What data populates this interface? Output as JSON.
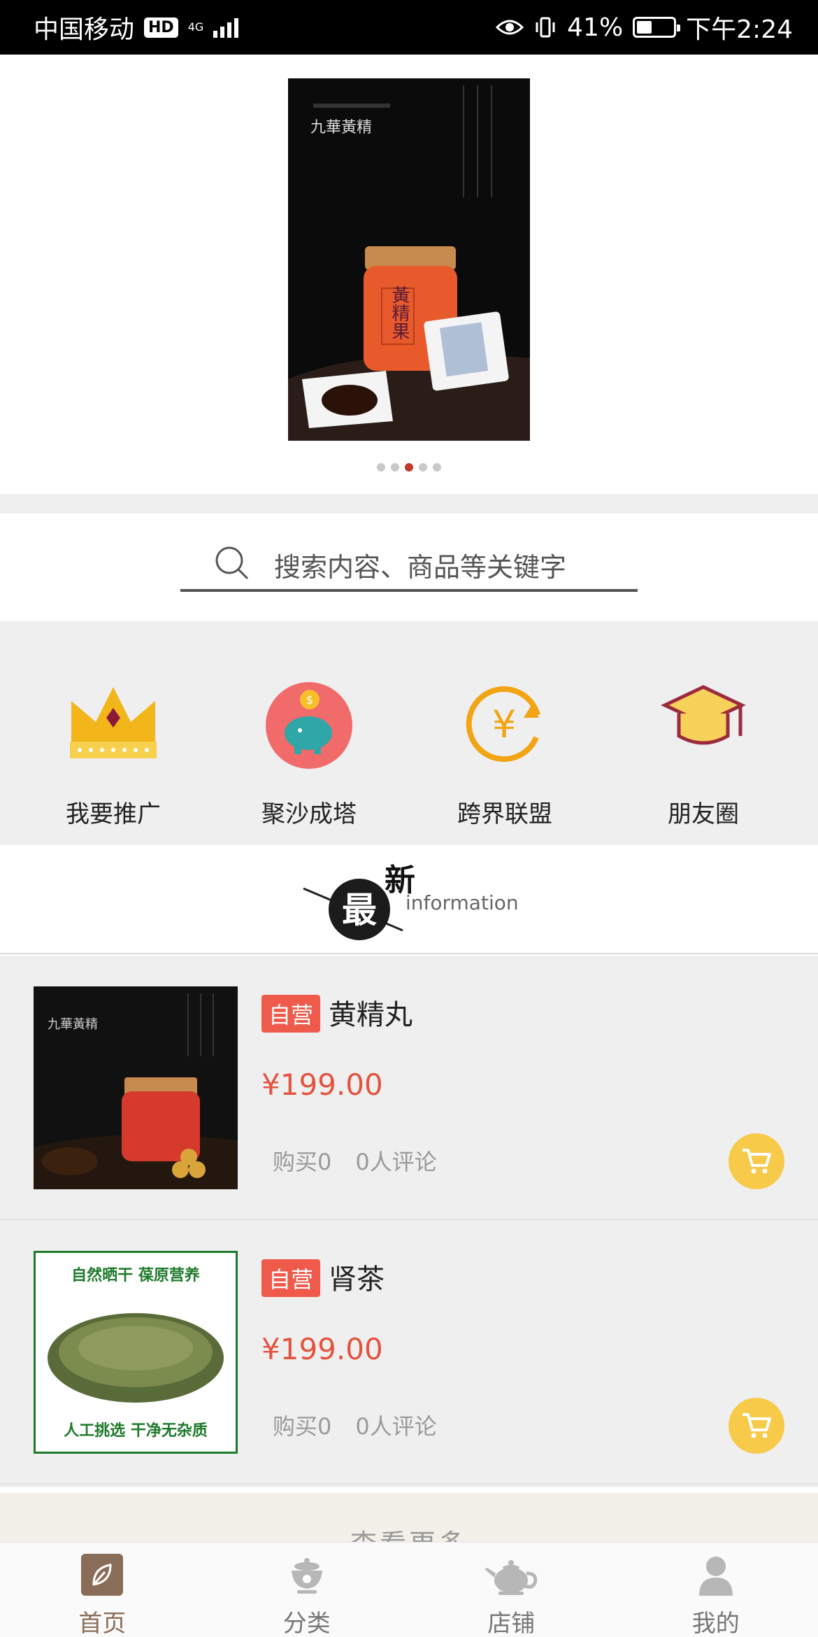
{
  "status_bar": {
    "carrier": "中国移动",
    "hd": "HD",
    "network": "4G",
    "battery": "41%",
    "battery_level": 0.41,
    "time": "下午2:24"
  },
  "banner": {
    "dots_count": 5,
    "active_index": 2,
    "image_text": {
      "brand": "九華黃精",
      "product": "黃精果"
    }
  },
  "search": {
    "placeholder": "搜索内容、商品等关键字"
  },
  "quick_menu": [
    {
      "label": "我要推广",
      "icon": "crown-icon"
    },
    {
      "label": "聚沙成塔",
      "icon": "piggy-bank-icon"
    },
    {
      "label": "跨界联盟",
      "icon": "yen-exchange-icon"
    },
    {
      "label": "朋友圈",
      "icon": "graduation-cap-icon"
    }
  ],
  "latest": {
    "char_main": "最",
    "char_new": "新",
    "en": "information"
  },
  "products": [
    {
      "tag": "自营",
      "name": "黄精丸",
      "price": "¥199.00",
      "bought": "购买0",
      "reviews": "0人评论",
      "image_text": {
        "brand": "九華黃精"
      }
    },
    {
      "tag": "自营",
      "name": "肾茶",
      "price": "¥199.00",
      "bought": "购买0",
      "reviews": "0人评论",
      "image_text": {
        "top": "自然晒干  葆原营养",
        "bottom": "人工挑选  干净无杂质"
      }
    }
  ],
  "more": {
    "label": "查看更多"
  },
  "tabs": [
    {
      "label": "首页",
      "icon": "leaf-icon",
      "active": true
    },
    {
      "label": "分类",
      "icon": "teacup-icon",
      "active": false
    },
    {
      "label": "店铺",
      "icon": "teapot-icon",
      "active": false
    },
    {
      "label": "我的",
      "icon": "user-icon",
      "active": false
    }
  ],
  "colors": {
    "accent": "#e55340",
    "tag": "#ef5a4b",
    "cart": "#f7ca4a",
    "tab_active": "#8a6d58"
  }
}
